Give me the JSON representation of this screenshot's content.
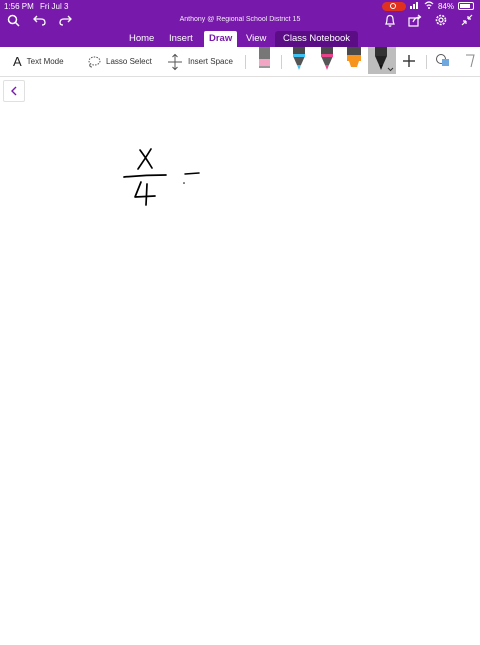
{
  "status_bar": {
    "time": "1:56 PM",
    "date": "Fri Jul 3",
    "battery_percent": "84%"
  },
  "header": {
    "title": "Anthony @ Regional School District 15",
    "icons": [
      "search-icon",
      "undo-icon",
      "redo-icon",
      "bell-icon",
      "share-icon",
      "gear-icon",
      "collapse-icon"
    ]
  },
  "tabs": [
    {
      "label": "Home"
    },
    {
      "label": "Insert"
    },
    {
      "label": "Draw",
      "active": true
    },
    {
      "label": "View"
    },
    {
      "label": "Class Notebook"
    }
  ],
  "ribbon": {
    "text_mode_label": "Text Mode",
    "lasso_select_label": "Lasso Select",
    "insert_space_label": "Insert Space",
    "tools": [
      {
        "name": "eraser",
        "color": "#f3a6c4"
      },
      {
        "name": "pen-blue",
        "color": "#3ec1f3"
      },
      {
        "name": "pen-pink",
        "color": "#e8428c"
      },
      {
        "name": "highlighter-orange",
        "color": "#f7941d"
      },
      {
        "name": "pen-black",
        "color": "#1a1a1a",
        "selected": true
      }
    ]
  },
  "canvas": {
    "ink": "x over 4 minus (handwritten)"
  },
  "colors": {
    "brand": "#7719aa",
    "class_notebook_tab": "#5b0d86",
    "record": "#e0301e"
  }
}
